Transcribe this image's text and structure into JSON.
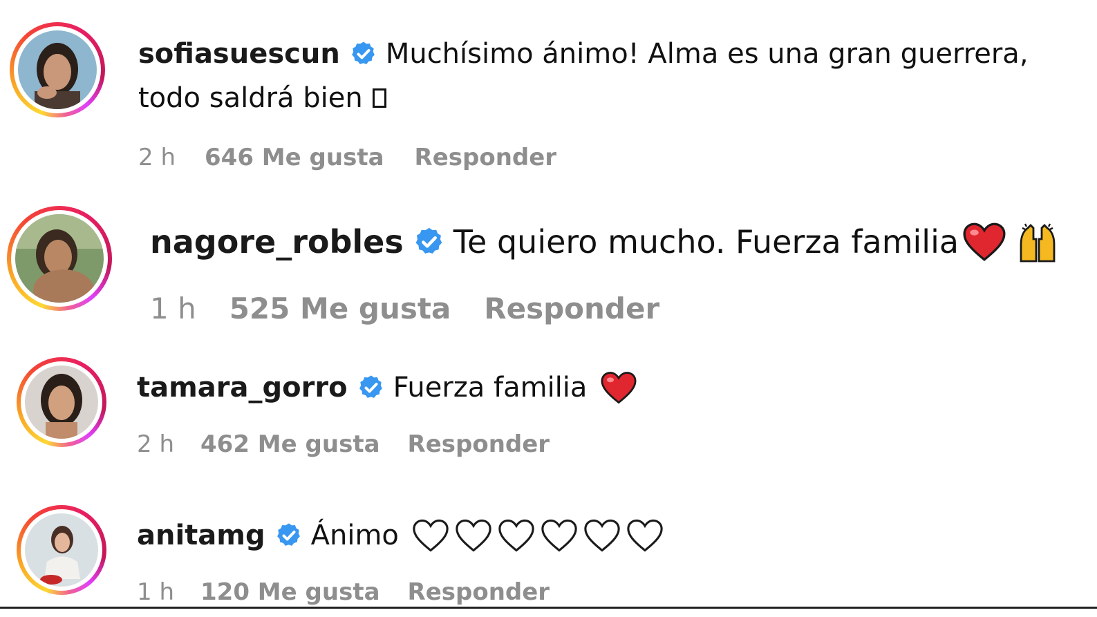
{
  "comments": [
    {
      "username": "sofiasuescun",
      "text_line1": "Muchísimo ánimo! Alma es una gran guerrera,",
      "text_line2": "todo saldrá bien",
      "time": "2 h",
      "likes": "646 Me gusta",
      "reply": "Responder"
    },
    {
      "username": "nagore_robles",
      "text": "Te quiero mucho. Fuerza familia",
      "time": "1 h",
      "likes": "525 Me gusta",
      "reply": "Responder"
    },
    {
      "username": "tamara_gorro",
      "text": "Fuerza familia",
      "time": "2 h",
      "likes": "462 Me gusta",
      "reply": "Responder"
    },
    {
      "username": "anitamg",
      "text": "Ánimo",
      "time": "1 h",
      "likes": "120 Me gusta",
      "reply": "Responder"
    }
  ],
  "icons": {
    "verified": "verified-badge-icon",
    "red_heart": "red-heart-icon",
    "raising_hands": "raising-hands-icon",
    "white_heart": "white-heart-icon"
  },
  "colors": {
    "verified_blue": "#3897f0",
    "meta_gray": "#8e8e8e",
    "heart_red": "#e0262f"
  }
}
